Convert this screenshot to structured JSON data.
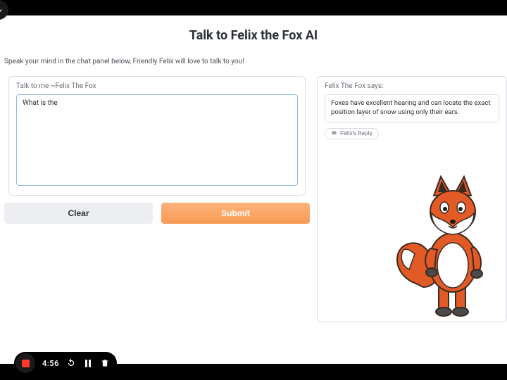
{
  "title": "Talk to Felix the Fox AI",
  "subtitle": "Speak your mind in the chat panel below, Friendly Felix will love to talk to you!",
  "input_panel": {
    "label": "Talk to me ~Felix The Fox",
    "value": "What is the "
  },
  "buttons": {
    "clear": "Clear",
    "submit": "Submit"
  },
  "reply_panel": {
    "label": "Felix The Fox says:",
    "text": "Foxes have excellent hearing and can locate the exact position layer of snow using only their ears.",
    "chip": "Felix's Reply"
  },
  "recorder": {
    "time": "4:56"
  }
}
